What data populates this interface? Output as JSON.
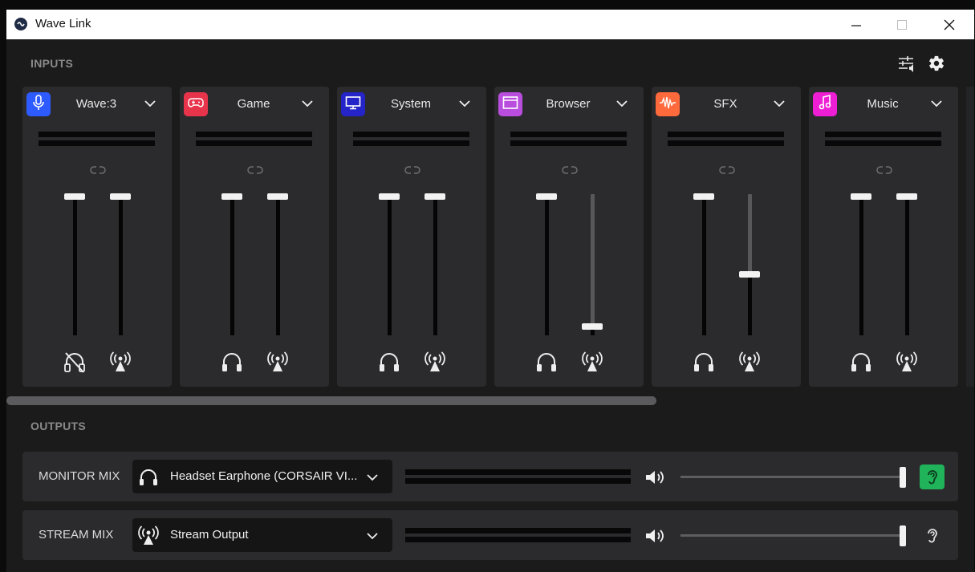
{
  "window": {
    "title": "Wave Link",
    "controls": [
      "minimize-icon",
      "maximize-icon",
      "close-icon"
    ]
  },
  "inputs": {
    "label": "INPUTS",
    "header_icons": [
      "mixer-settings-icon",
      "gear-icon"
    ],
    "channels": [
      {
        "name": "Wave:3",
        "icon": "microphone-icon",
        "color": "#2e5bff",
        "monitor_level": 1.0,
        "stream_level": 1.0,
        "monitor_icon": "headphones-muted-icon",
        "stream_icon": "broadcast-icon"
      },
      {
        "name": "Game",
        "icon": "gamepad-icon",
        "color": "#e8344b",
        "monitor_level": 1.0,
        "stream_level": 1.0,
        "monitor_icon": "headphones-icon",
        "stream_icon": "broadcast-icon"
      },
      {
        "name": "System",
        "icon": "monitor-icon",
        "color": "#2424c8",
        "monitor_level": 1.0,
        "stream_level": 1.0,
        "monitor_icon": "headphones-icon",
        "stream_icon": "broadcast-icon"
      },
      {
        "name": "Browser",
        "icon": "browser-window-icon",
        "color": "#b84dde",
        "monitor_level": 1.0,
        "stream_level": 0.0,
        "monitor_icon": "headphones-icon",
        "stream_icon": "broadcast-icon"
      },
      {
        "name": "SFX",
        "icon": "waveform-icon",
        "color": "#ff6a3d",
        "monitor_level": 1.0,
        "stream_level": 0.4,
        "monitor_icon": "headphones-icon",
        "stream_icon": "broadcast-icon"
      },
      {
        "name": "Music",
        "icon": "music-note-icon",
        "color": "#ee1ed4",
        "monitor_level": 1.0,
        "stream_level": 1.0,
        "monitor_icon": "headphones-icon",
        "stream_icon": "broadcast-icon"
      }
    ],
    "scroll_position": 0.0
  },
  "outputs": {
    "label": "OUTPUTS",
    "mixes": [
      {
        "label": "MONITOR MIX",
        "device": "Headset Earphone (CORSAIR VI...",
        "device_icon": "headphones-icon",
        "volume": 1.0,
        "listen_active": true,
        "listen_color": "#21b35a"
      },
      {
        "label": "STREAM MIX",
        "device": "Stream Output",
        "device_icon": "broadcast-icon",
        "volume": 1.0,
        "listen_active": false
      }
    ]
  }
}
